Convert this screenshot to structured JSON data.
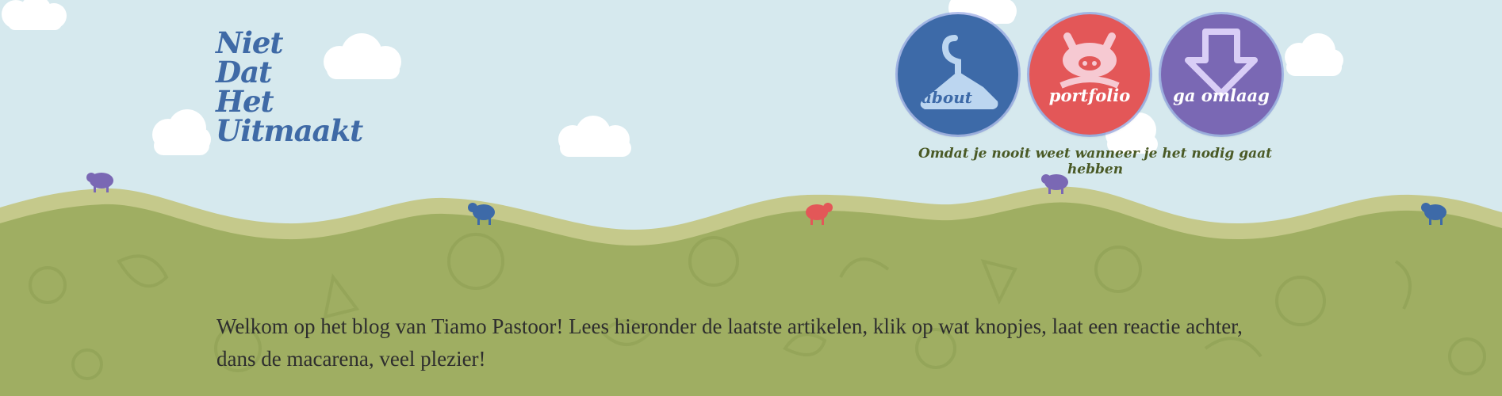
{
  "logo": {
    "lines": [
      "Niet",
      "Dat",
      "Het",
      "Uitmaakt"
    ]
  },
  "nav": {
    "about_label": "about",
    "portfolio_label": "portfolio",
    "down_label": "ga omlaag",
    "about_icon": "hanger-icon",
    "portfolio_icon": "pig-icon",
    "down_icon": "down-arrow-icon"
  },
  "tagline": "Omdat je nooit weet wanneer je het nodig gaat hebben",
  "welcome": "Welkom op het blog van Tiamo Pastoor! Lees hieronder de laatste artikelen, klik op wat knopjes, laat een reactie achter, dans de macarena, veel plezier!",
  "colors": {
    "sky": "#d6e9ee",
    "grass_top": "#c5c98b",
    "ground": "#9fae62",
    "about": "#3d6aa8",
    "portfolio": "#e35758",
    "down": "#7a68b4",
    "logo": "#3f6aa6"
  }
}
